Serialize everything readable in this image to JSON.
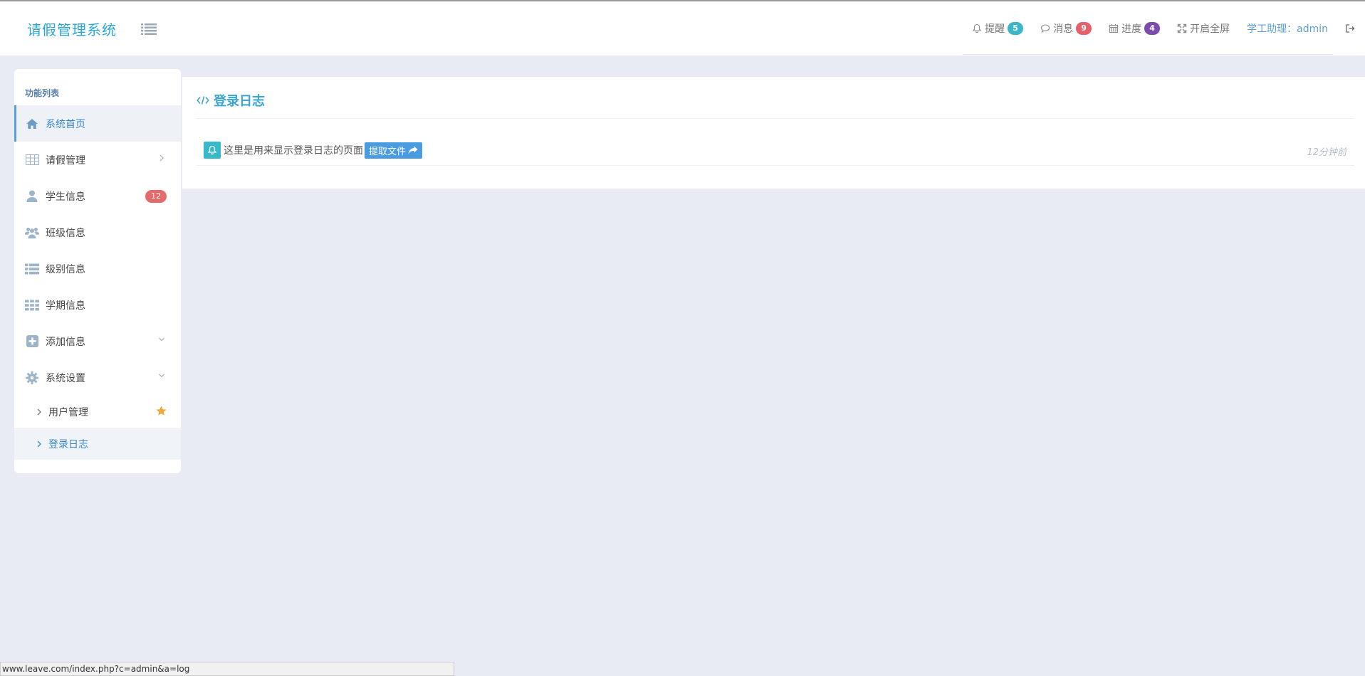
{
  "brand": {
    "title": "请假管理系统"
  },
  "navbar": {
    "remind": {
      "label": "提醒",
      "count": "5",
      "color": "#3ab6c8"
    },
    "message": {
      "label": "消息",
      "count": "9",
      "color": "#e6606a"
    },
    "progress": {
      "label": "进度",
      "count": "4",
      "color": "#7b4bb0"
    },
    "fullscreen": {
      "label": "开启全屏"
    },
    "user": {
      "label": "学工助理：admin"
    }
  },
  "sidebar": {
    "header": "功能列表",
    "items": [
      {
        "label": "系统首页",
        "icon": "home-icon"
      },
      {
        "label": "请假管理",
        "icon": "table-icon"
      },
      {
        "label": "学生信息",
        "icon": "user-icon",
        "badge": "12"
      },
      {
        "label": "班级信息",
        "icon": "users-icon"
      },
      {
        "label": "级别信息",
        "icon": "list-icon"
      },
      {
        "label": "学期信息",
        "icon": "grid-icon"
      },
      {
        "label": "添加信息",
        "icon": "plus-square-icon"
      },
      {
        "label": "系统设置",
        "icon": "gear-icon"
      }
    ],
    "subitems": [
      {
        "label": "用户管理"
      },
      {
        "label": "登录日志"
      }
    ]
  },
  "main": {
    "title": "登录日志",
    "log": {
      "text": "这里是用来显示登录日志的页面",
      "button": "提取文件",
      "time": "12分钟前"
    }
  },
  "statusbar": {
    "url": "www.leave.com/index.php?c=admin&a=log"
  },
  "colors": {
    "accent": "#3aa6d0",
    "background": "#e8ebf3",
    "danger": "#e66a6a"
  }
}
